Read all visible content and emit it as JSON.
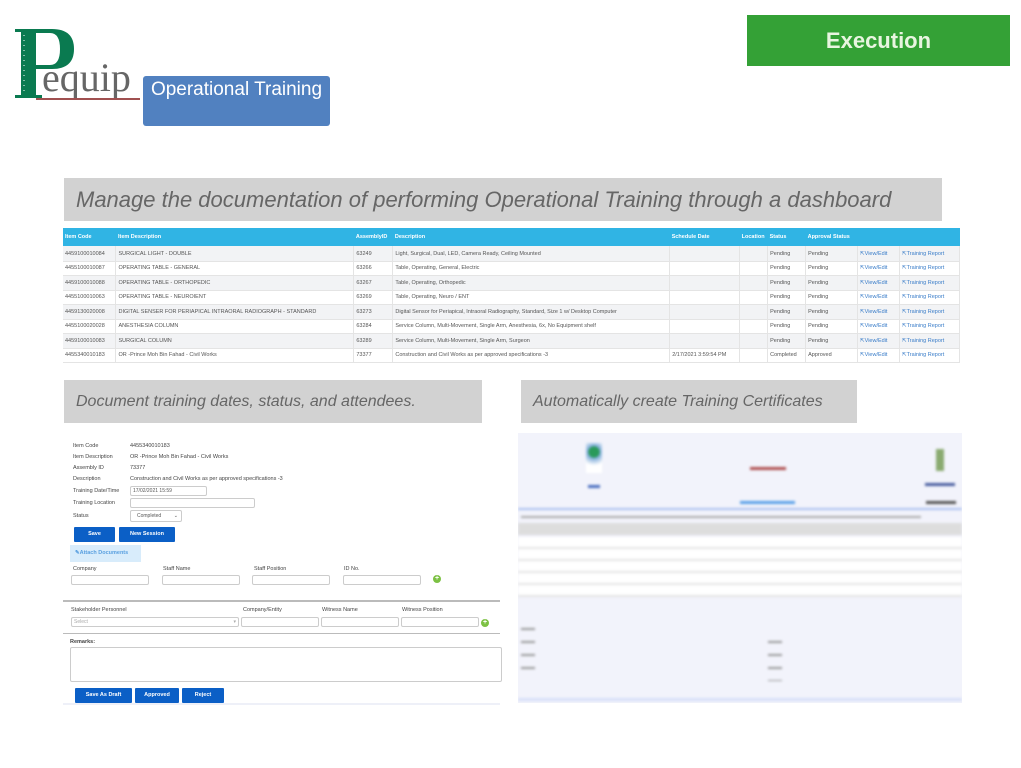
{
  "header": {
    "execution_label": "Execution",
    "logo_text": "Pequip",
    "section_label": "Operational Training"
  },
  "captions": {
    "dashboard": "Manage the documentation of performing Operational Training through a dashboard",
    "form": "Document training dates, status, and attendees.",
    "certificate": "Automatically create Training Certificates"
  },
  "table": {
    "columns": [
      "Item Code",
      "Item Description",
      "AssemblyID",
      "Description",
      "Schedule Date",
      "Location",
      "Status",
      "Approval Status",
      "",
      ""
    ],
    "link_view": "View/Edit",
    "link_report": "Training Report",
    "rows": [
      [
        "4459100010084",
        "SURGICAL LIGHT - DOUBLE",
        "63249",
        "Light, Surgical, Dual, LED, Camera Ready, Ceiling Mounted",
        "",
        "",
        "Pending",
        "Pending"
      ],
      [
        "4455100010087",
        "OPERATING TABLE - GENERAL",
        "63266",
        "Table, Operating, General, Electric",
        "",
        "",
        "Pending",
        "Pending"
      ],
      [
        "4459100010088",
        "OPERATING TABLE - ORTHOPEDIC",
        "63267",
        "Table, Operating, Orthopedic",
        "",
        "",
        "Pending",
        "Pending"
      ],
      [
        "4455100010063",
        "OPERATING TABLE - NEUROIENT",
        "63269",
        "Table, Operating, Neuro / ENT",
        "",
        "",
        "Pending",
        "Pending"
      ],
      [
        "4459130020008",
        "DIGITAL SENSER FOR PERIAPICAL INTRAORAL RADIOGRAPH - STANDARD",
        "63273",
        "Digital Sensor for Periapical, Intraoral Radiography, Standard, Size 1 w/ Desktop Computer",
        "",
        "",
        "Pending",
        "Pending"
      ],
      [
        "4455100020028",
        "ANESTHESIA COLUMN",
        "63284",
        "Service Column, Multi-Movement, Single Arm, Anesthesia, 6x, No Equipment shelf",
        "",
        "",
        "Pending",
        "Pending"
      ],
      [
        "4459100010083",
        "SURGICAL COLUMN",
        "63289",
        "Service Column, Multi-Movement, Single Arm, Surgeon",
        "",
        "",
        "Pending",
        "Pending"
      ],
      [
        "4455340010183",
        "OR -Prince Moh Bin Fahad - Civil Works",
        "73377",
        "Construction and Civil Works as per approved specifications -3",
        "2/17/2021 3:59:54 PM",
        "",
        "Completed",
        "Approved"
      ]
    ]
  },
  "form": {
    "item_code_label": "Item Code",
    "item_code": "4455340010183",
    "item_desc_label": "Item Description",
    "item_desc": "OR -Prince Moh Bin Fahad - Civil Works",
    "assembly_label": "Assembly ID",
    "assembly": "73377",
    "desc_label": "Description",
    "desc": "Construction and Civil Works as per approved specifications -3",
    "date_label": "Training Date/Time",
    "date": "17/02/2021 15:59",
    "location_label": "Training Location",
    "location": "",
    "status_label": "Status",
    "status": "Completed",
    "save": "Save",
    "new_session": "New Session",
    "attach": "✎Attach Documents",
    "company": "Company",
    "staff_name": "Staff Name",
    "staff_position": "Staff Position",
    "id_no": "ID No.",
    "stakeholder": "Stakeholder Personnel",
    "stakeholder_placeholder": "Select",
    "company_entity": "Company/Entity",
    "witness_name": "Witness Name",
    "witness_position": "Witness Position",
    "remarks": "Remarks:",
    "save_draft": "Save As Draft",
    "approved": "Approved",
    "reject": "Reject"
  },
  "colors": {
    "execution": "#34a136",
    "section": "#5181c0",
    "table_header": "#30b4e4",
    "button": "#0b5fc6",
    "logo_green": "#0a7a50"
  }
}
